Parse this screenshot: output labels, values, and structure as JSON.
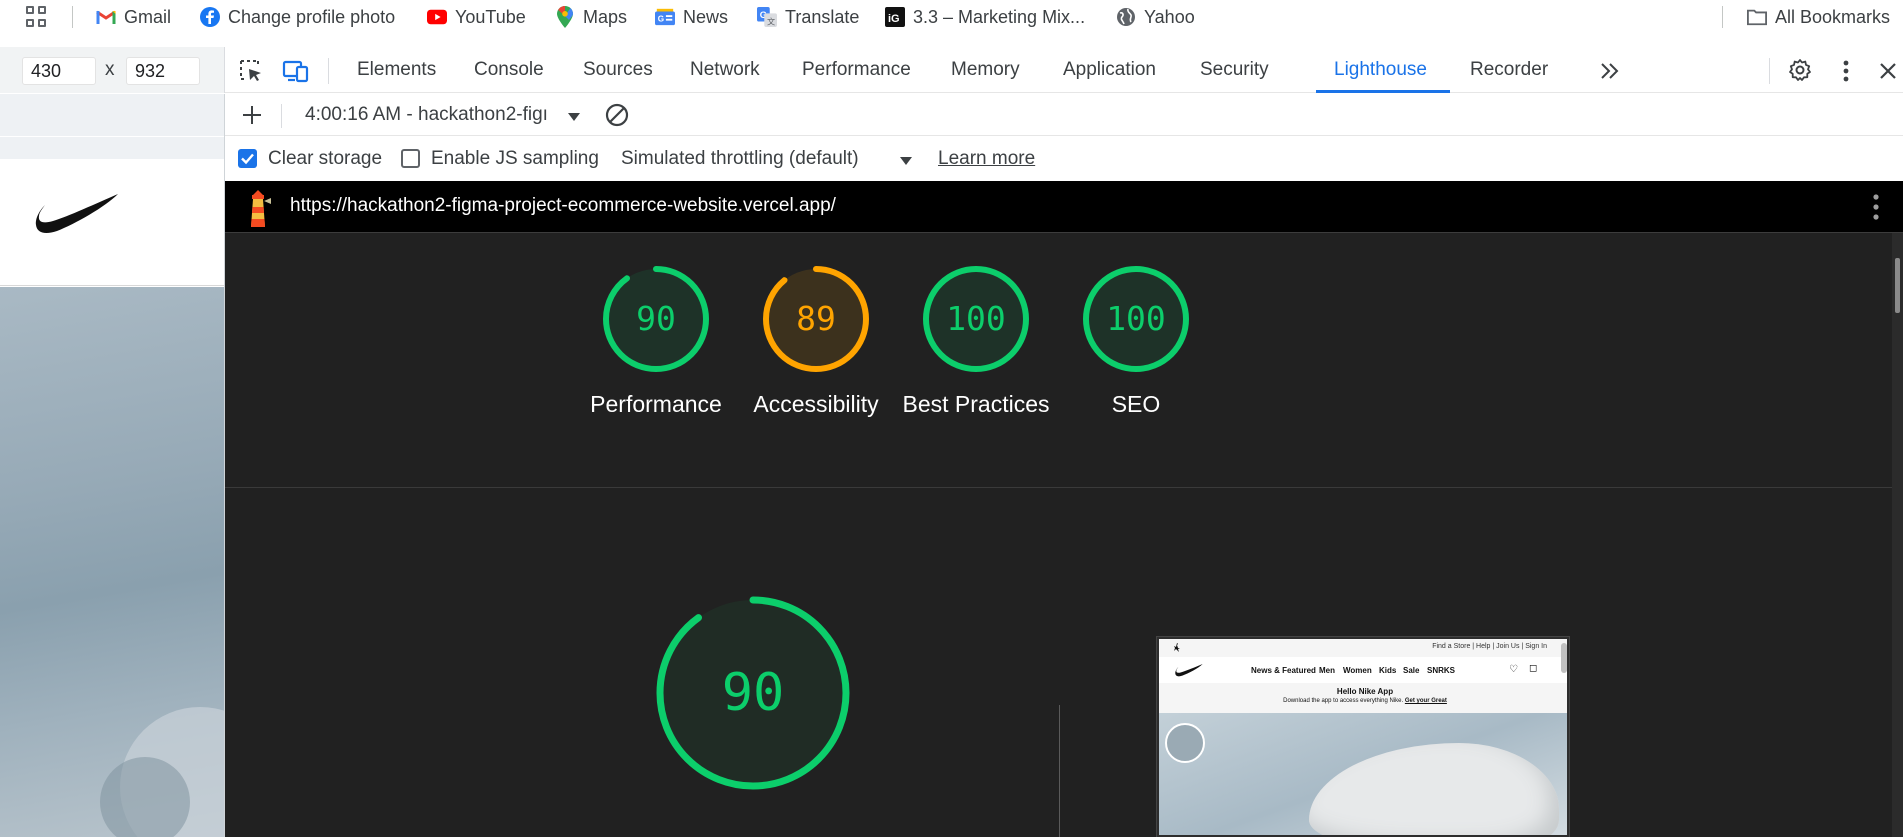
{
  "bookmarks": {
    "items": [
      {
        "label": "Gmail",
        "icon": "gmail-icon"
      },
      {
        "label": "Change profile photo",
        "icon": "facebook-icon"
      },
      {
        "label": "YouTube",
        "icon": "youtube-icon"
      },
      {
        "label": "Maps",
        "icon": "maps-pin-icon"
      },
      {
        "label": "News",
        "icon": "google-news-icon"
      },
      {
        "label": "Translate",
        "icon": "google-translate-icon"
      },
      {
        "label": "3.3 – Marketing Mix...",
        "icon": "ig-icon"
      },
      {
        "label": "Yahoo",
        "icon": "globe-icon"
      }
    ],
    "all_bookmarks": "All Bookmarks"
  },
  "device": {
    "width": "430",
    "height": "932",
    "separator": "x"
  },
  "devtools": {
    "tabs": [
      "Elements",
      "Console",
      "Sources",
      "Network",
      "Performance",
      "Memory",
      "Application",
      "Security",
      "Lighthouse",
      "Recorder"
    ],
    "active_tab": "Lighthouse",
    "more_tabs": "»"
  },
  "lighthouse_toolbar": {
    "report_select": "4:00:16 AM - hackathon2-figı",
    "clear_storage": {
      "label": "Clear storage",
      "checked": true
    },
    "js_sampling": {
      "label": "Enable JS sampling",
      "checked": false
    },
    "throttling": "Simulated throttling (default)",
    "learn_more": "Learn more"
  },
  "report": {
    "url": "https://hackathon2-figma-project-ecommerce-website.vercel.app/",
    "scores": [
      {
        "label": "Performance",
        "score": 90,
        "color": "#0cce6b"
      },
      {
        "label": "Accessibility",
        "score": 89,
        "color": "#ffa400"
      },
      {
        "label": "Best Practices",
        "score": 100,
        "color": "#0cce6b"
      },
      {
        "label": "SEO",
        "score": 100,
        "color": "#0cce6b"
      }
    ],
    "main_score": 90,
    "main_color": "#0cce6b"
  },
  "thumbnail": {
    "top_links": "Find a Store  |  Help  |  Join Us  |  Sign In",
    "nav": [
      "News & Featured",
      "Men",
      "Women",
      "Kids",
      "Sale",
      "SNRKS"
    ],
    "promo_title": "Hello Nike App",
    "promo_text": "Download the app to access everything Nike.",
    "promo_link": "Get your Great"
  }
}
